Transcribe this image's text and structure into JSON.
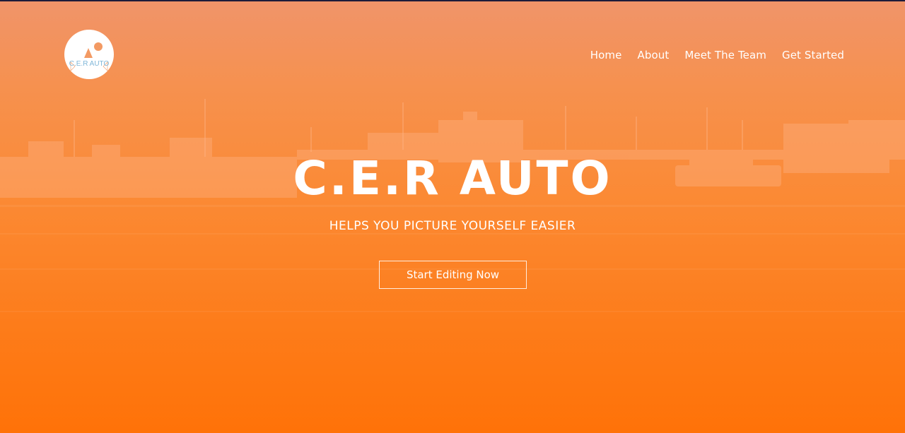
{
  "brand": {
    "logo_text": "C.E.R AUTO"
  },
  "nav": {
    "items": [
      {
        "label": "Home"
      },
      {
        "label": "About"
      },
      {
        "label": "Meet The Team"
      },
      {
        "label": "Get Started"
      }
    ]
  },
  "hero": {
    "title": "C.E.R AUTO",
    "tagline": "HELPS YOU PICTURE YOURSELF EASIER",
    "cta_label": "Start Editing Now"
  },
  "colors": {
    "overlay_top": "#f0946a",
    "overlay_bottom": "#ff7208",
    "text": "#ffffff",
    "logo_accent": "#7fb6d8"
  }
}
